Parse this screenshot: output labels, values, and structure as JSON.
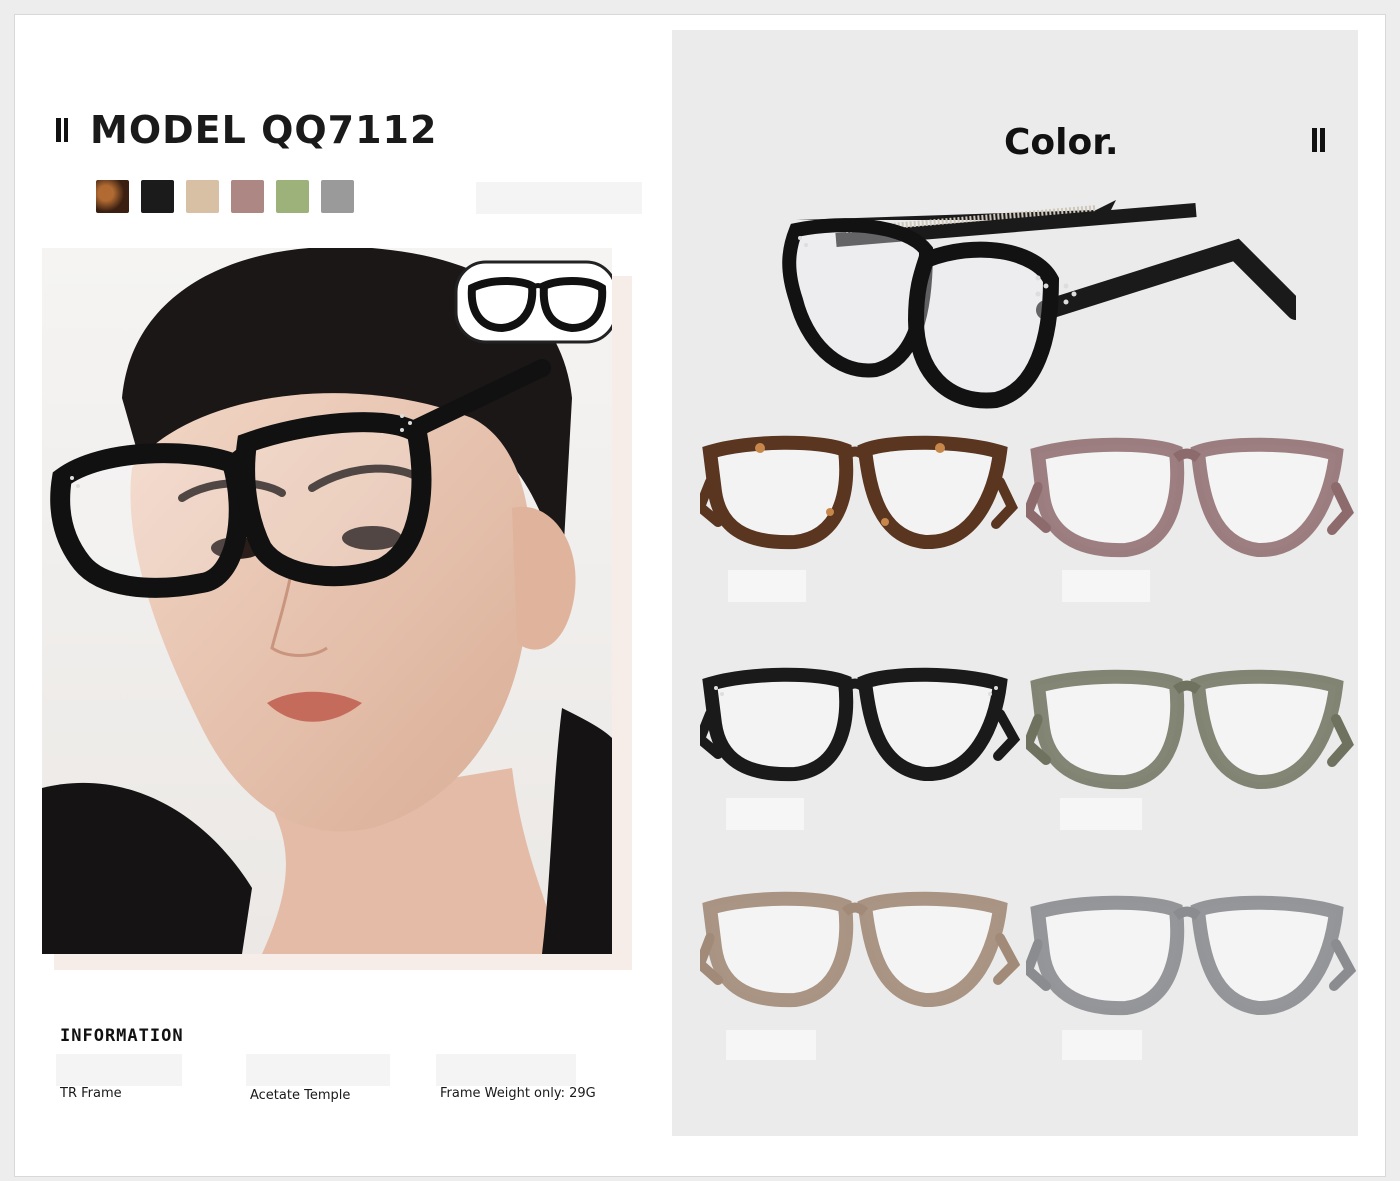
{
  "header": {
    "model_label": "MODEL  QQ7112"
  },
  "swatches": [
    {
      "name": "tortoise",
      "color": "#6b3d22"
    },
    {
      "name": "black",
      "color": "#1b1b1b"
    },
    {
      "name": "beige",
      "color": "#d8c0a4"
    },
    {
      "name": "mauve",
      "color": "#ad8783"
    },
    {
      "name": "green",
      "color": "#9db27a"
    },
    {
      "name": "grey",
      "color": "#9a9a9a"
    }
  ],
  "color_section": {
    "title": "Color."
  },
  "information": {
    "heading": "INFORMATION",
    "items": [
      "TR Frame",
      "Acetate Temple",
      "Frame Weight only: 29G"
    ]
  },
  "frames": [
    {
      "variant": "tortoise",
      "color": "#5a3520"
    },
    {
      "variant": "mauve",
      "color": "#8d6a6c"
    },
    {
      "variant": "black",
      "color": "#1a1a1a"
    },
    {
      "variant": "olive",
      "color": "#6e725e"
    },
    {
      "variant": "brown",
      "color": "#a28a78"
    },
    {
      "variant": "grey",
      "color": "#8a8c8f"
    }
  ]
}
